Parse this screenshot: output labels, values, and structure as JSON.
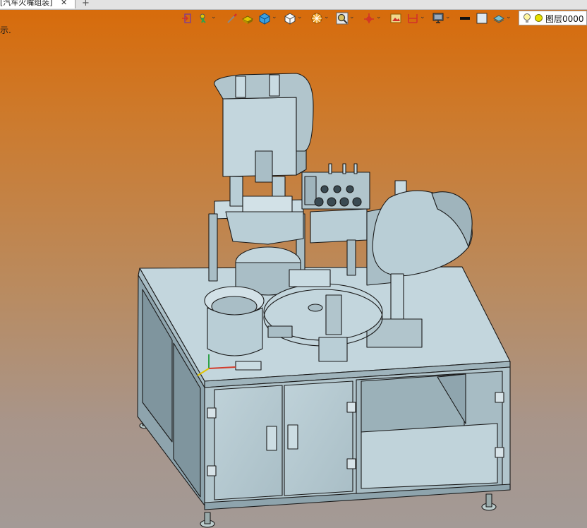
{
  "app": {
    "document_tab": {
      "title": "[汽车火嘴组装]",
      "close_glyph": "✕"
    },
    "new_tab_glyph": "+",
    "hint_text": "示."
  },
  "toolbar": {
    "items": [
      {
        "name": "exit-icon",
        "has_dropdown": false
      },
      {
        "name": "cursor-icon",
        "has_dropdown": true
      },
      {
        "name": "pen-icon",
        "has_dropdown": false
      },
      {
        "name": "material-icon",
        "has_dropdown": false
      },
      {
        "name": "cube-blue-icon",
        "has_dropdown": true
      },
      {
        "name": "cube-white-icon",
        "has_dropdown": true
      },
      {
        "name": "render-icon",
        "has_dropdown": true
      },
      {
        "name": "zoom-icon",
        "has_dropdown": true
      },
      {
        "name": "axis-icon",
        "has_dropdown": true
      },
      {
        "name": "image-icon",
        "has_dropdown": false
      },
      {
        "name": "dimension-icon",
        "has_dropdown": true
      },
      {
        "name": "monitor-icon",
        "has_dropdown": true
      },
      {
        "name": "line-color-icon",
        "has_dropdown": false
      },
      {
        "name": "fill-color-icon",
        "has_dropdown": false
      },
      {
        "name": "layer-stack-icon",
        "has_dropdown": true
      }
    ],
    "layer": {
      "name": "图层0000"
    }
  },
  "colors": {
    "model_fill": "#b9ced6",
    "model_light": "#c9dbe2",
    "model_dark": "#8fa5ae",
    "outline": "#1a1a1a",
    "accent_red": "#d23c2c",
    "accent_yellow": "#e2c500",
    "accent_green": "#2fa24a"
  }
}
